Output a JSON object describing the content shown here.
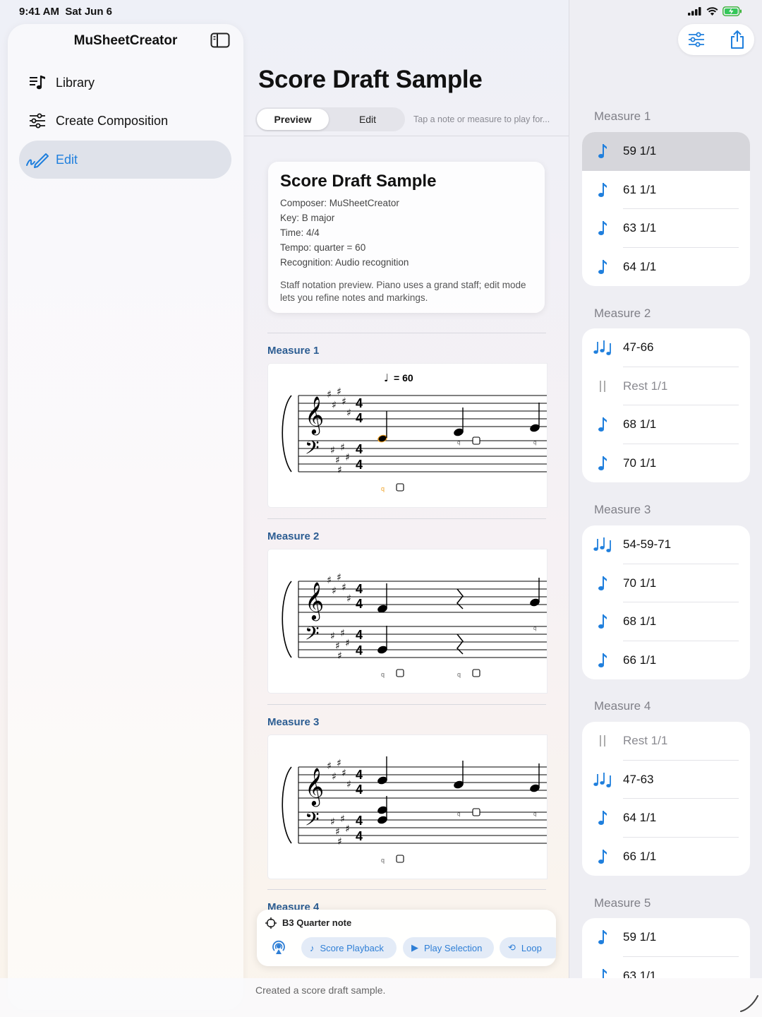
{
  "status_bar": {
    "time": "9:41 AM",
    "date": "Sat Jun 6"
  },
  "sidebar": {
    "title": "MuSheetCreator",
    "items": [
      {
        "label": "Library",
        "icon": "music-list-icon",
        "active": false
      },
      {
        "label": "Create Composition",
        "icon": "sliders-icon",
        "active": false
      },
      {
        "label": "Edit",
        "icon": "pencil-scribble-icon",
        "active": true
      }
    ]
  },
  "main": {
    "title": "Score Draft Sample",
    "segments": [
      "Preview",
      "Edit"
    ],
    "selected_segment": "Preview",
    "hint": "Tap a note or measure to play for...",
    "info_card": {
      "title": "Score Draft Sample",
      "lines": [
        "Composer: MuSheetCreator",
        "Key: B major",
        "Time: 4/4",
        "Tempo: quarter = 60",
        "Recognition: Audio recognition"
      ],
      "note": "Staff notation preview. Piano uses a grand staff; edit mode lets you refine notes and markings."
    },
    "measures": [
      {
        "label": "Measure 1",
        "tempo_mark": "= 60"
      },
      {
        "label": "Measure 2"
      },
      {
        "label": "Measure 3"
      },
      {
        "label": "Measure 4"
      }
    ],
    "time_signature": [
      "4",
      "4"
    ],
    "note_marker": "q"
  },
  "player": {
    "selection": "B3 Quarter note",
    "buttons": [
      "Score Playback",
      "Play Selection",
      "Loop"
    ]
  },
  "status_message": "Created a score draft sample.",
  "right_panel": {
    "measures": [
      {
        "label": "Measure 1",
        "items": [
          {
            "icon": "note",
            "text": "59  1/1",
            "selected": true
          },
          {
            "icon": "note",
            "text": "61  1/1"
          },
          {
            "icon": "note",
            "text": "63  1/1"
          },
          {
            "icon": "note",
            "text": "64  1/1"
          }
        ]
      },
      {
        "label": "Measure 2",
        "items": [
          {
            "icon": "chord",
            "text": "47-66"
          },
          {
            "icon": "rest",
            "text": "Rest 1/1"
          },
          {
            "icon": "note",
            "text": "68  1/1"
          },
          {
            "icon": "note",
            "text": "70  1/1"
          }
        ]
      },
      {
        "label": "Measure 3",
        "items": [
          {
            "icon": "chord",
            "text": "54-59-71"
          },
          {
            "icon": "note",
            "text": "70  1/1"
          },
          {
            "icon": "note",
            "text": "68  1/1"
          },
          {
            "icon": "note",
            "text": "66  1/1"
          }
        ]
      },
      {
        "label": "Measure 4",
        "items": [
          {
            "icon": "rest",
            "text": "Rest 1/1"
          },
          {
            "icon": "chord",
            "text": "47-63"
          },
          {
            "icon": "note",
            "text": "64  1/1"
          },
          {
            "icon": "note",
            "text": "66  1/1"
          }
        ]
      },
      {
        "label": "Measure 5",
        "items": [
          {
            "icon": "note",
            "text": "59  1/1"
          },
          {
            "icon": "note",
            "text": "63  1/1"
          }
        ]
      }
    ]
  },
  "colors": {
    "accent": "#1f7fdd",
    "selected_note": "#f0a020",
    "measure_label": "#2c5d92"
  }
}
